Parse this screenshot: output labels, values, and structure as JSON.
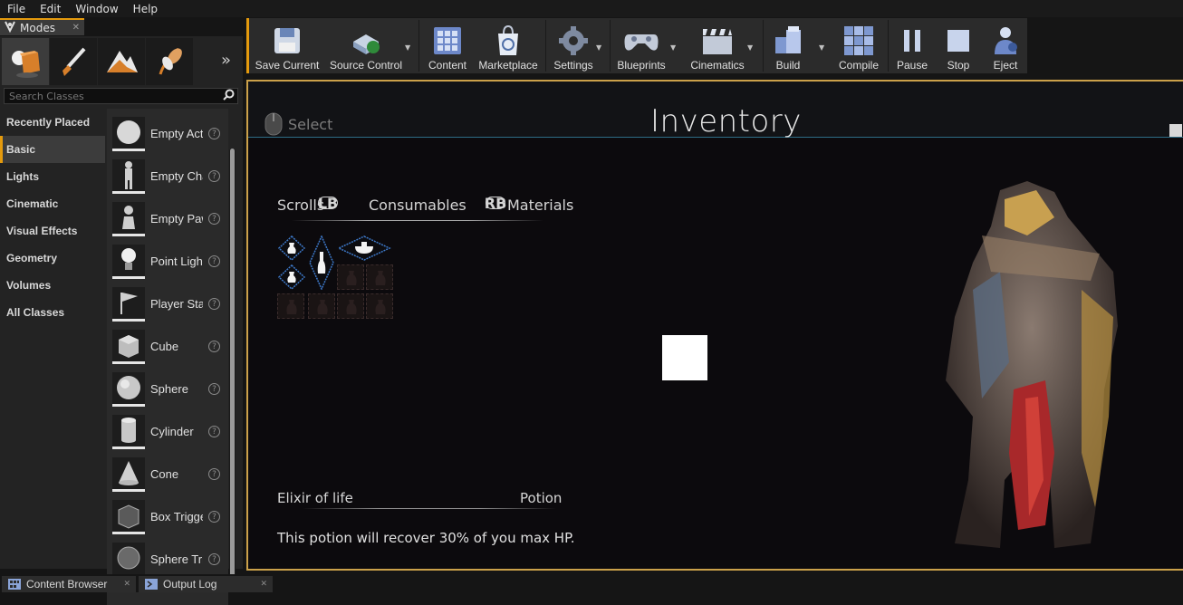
{
  "menu": [
    "File",
    "Edit",
    "Window",
    "Help"
  ],
  "modes": {
    "tab_label": "Modes",
    "search_placeholder": "Search Classes",
    "categories": [
      "Recently Placed",
      "Basic",
      "Lights",
      "Cinematic",
      "Visual Effects",
      "Geometry",
      "Volumes",
      "All Classes"
    ],
    "active_category": "Basic",
    "items": [
      "Empty Actor",
      "Empty Character",
      "Empty Pawn",
      "Point Light",
      "Player Start",
      "Cube",
      "Sphere",
      "Cylinder",
      "Cone",
      "Box Trigger",
      "Sphere Trigger"
    ],
    "help": "?"
  },
  "toolbar": {
    "buttons": [
      "Save Current",
      "Source Control",
      "Content",
      "Marketplace",
      "Settings",
      "Blueprints",
      "Cinematics",
      "Build",
      "Compile",
      "Pause",
      "Stop",
      "Eject"
    ]
  },
  "viewport": {
    "select_label": "Select",
    "title": "Inventory",
    "tabs": [
      "Scrolls",
      "Consumables",
      "Materials"
    ],
    "lb": "LB",
    "rb": "RB",
    "item_name": "Elixir of life",
    "item_type": "Potion",
    "item_description": "This potion will recover 30% of you max HP."
  },
  "bottom_tabs": [
    "Content Browser",
    "Output Log"
  ],
  "colors": {
    "accent": "#e49a0d",
    "viewport_border": "#cba14a",
    "slot_highlight": "#3d78c8"
  }
}
